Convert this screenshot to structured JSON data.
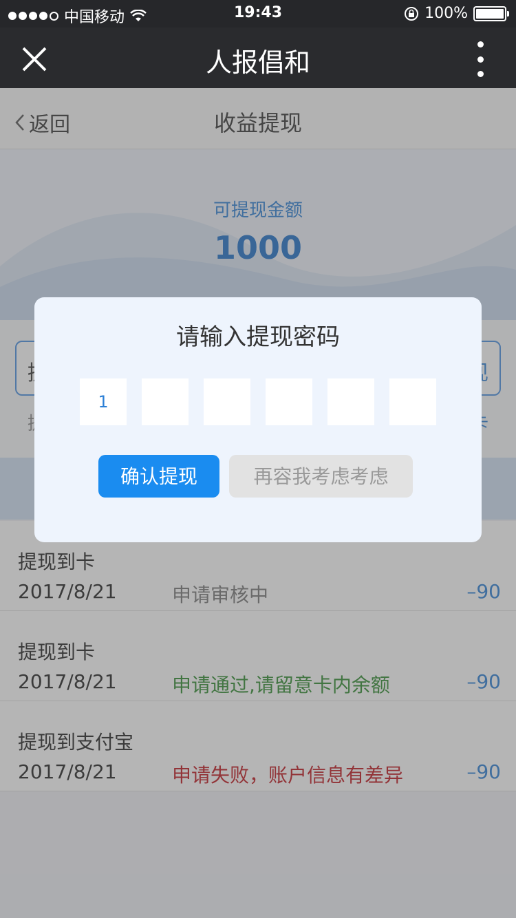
{
  "status_bar": {
    "carrier": "中国移动",
    "time": "19:43",
    "battery": "100%"
  },
  "nav": {
    "title": "人报倡和"
  },
  "header": {
    "back_label": "返回",
    "title": "收益提现"
  },
  "hero": {
    "label": "可提现金额",
    "amount": "1000"
  },
  "withdraw": {
    "left_label": "提",
    "right_label": "现",
    "hint_left": "提",
    "hint_right": "卡"
  },
  "records": [
    {
      "title": "提现到卡",
      "date": "2017/8/21",
      "status": "申请审核中",
      "status_color": "#777777",
      "amount": "–90"
    },
    {
      "title": "提现到卡",
      "date": "2017/8/21",
      "status": "申请通过,请留意卡内余额",
      "status_color": "#2e8b2e",
      "amount": "–90"
    },
    {
      "title": "提现到支付宝",
      "date": "2017/8/21",
      "status": "申请失败，账户信息有差异",
      "status_color": "#c0141c",
      "amount": "–90"
    }
  ],
  "modal": {
    "title": "请输入提现密码",
    "pins": [
      "1",
      "",
      "",
      "",
      "",
      ""
    ],
    "confirm_label": "确认提现",
    "cancel_label": "再容我考虑考虑"
  },
  "colors": {
    "accent": "#1a8cf0",
    "amount_blue": "#1e6fc8"
  }
}
